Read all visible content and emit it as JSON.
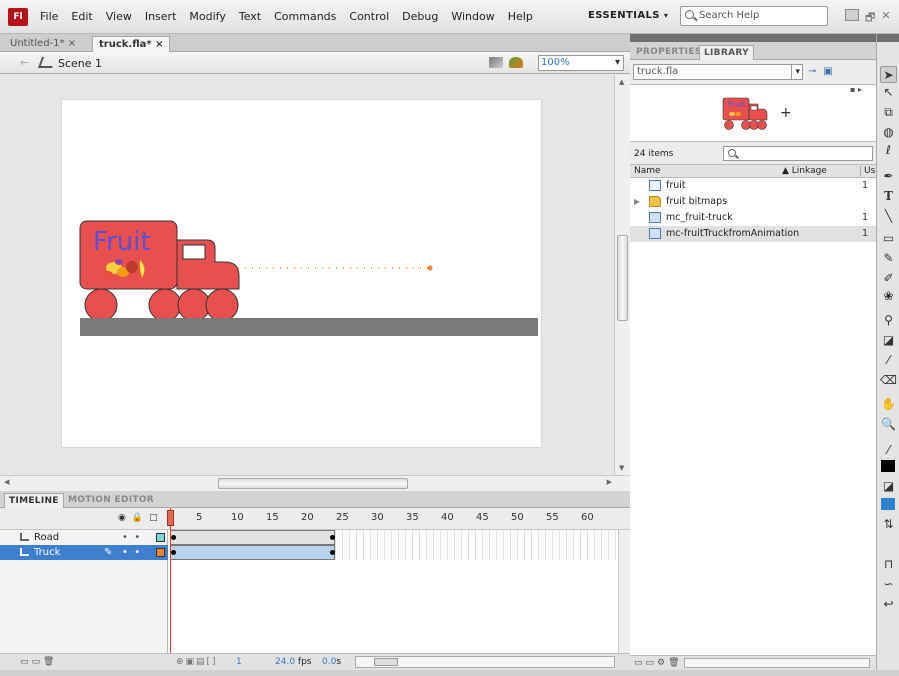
{
  "app": {
    "logo": "Fl"
  },
  "menu": [
    "File",
    "Edit",
    "View",
    "Insert",
    "Modify",
    "Text",
    "Commands",
    "Control",
    "Debug",
    "Window",
    "Help"
  ],
  "workspace": {
    "label": "ESSENTIALS",
    "arrow": "▾"
  },
  "search": {
    "placeholder": "Search Help"
  },
  "window_controls": [
    "",
    "🗗",
    "✕"
  ],
  "doc_tabs": [
    {
      "label": "Untitled-1* ×"
    },
    {
      "label": "truck.fla* ×"
    }
  ],
  "editbar": {
    "scene": "Scene 1",
    "zoom": "100%"
  },
  "stage": {
    "truck_text": "Fruit",
    "colors": {
      "truck": "#e85050",
      "road": "#7a7a7a",
      "path": "#f0832a",
      "stage_bg": "#ffffff"
    }
  },
  "timeline": {
    "tabs": [
      "TIMELINE",
      "MOTION EDITOR"
    ],
    "frame_numbers": [
      "5",
      "10",
      "15",
      "20",
      "25",
      "30",
      "35",
      "40",
      "45",
      "50",
      "55",
      "60"
    ],
    "layers": [
      {
        "name": "Road",
        "selected": false,
        "color": "#7fd8d8"
      },
      {
        "name": "Truck",
        "selected": true,
        "color": "#f0832a"
      }
    ],
    "current_frame": "1",
    "fps": "24.0",
    "fps_unit": "fps",
    "time": "0.0",
    "time_unit": "s"
  },
  "panel": {
    "tabs": [
      "PROPERTIES",
      "LIBRARY"
    ],
    "library_file": "truck.fla",
    "item_count": "24 items",
    "columns": {
      "name": "Name",
      "linkage": "Linkage",
      "use": "Us"
    },
    "items": [
      {
        "name": "fruit",
        "type": "graphic",
        "use": "1",
        "selected": false
      },
      {
        "name": "fruit bitmaps",
        "type": "folder",
        "use": "",
        "selected": false
      },
      {
        "name": "mc_fruit-truck",
        "type": "movieclip",
        "use": "1",
        "selected": false
      },
      {
        "name": "mc-fruitTruckfromAnimation",
        "type": "movieclip",
        "use": "1",
        "selected": true
      }
    ]
  },
  "tools": [
    "selection-tool",
    "subselection-tool",
    "free-transform-tool",
    "3d-rotation-tool",
    "lasso-tool",
    "pen-tool",
    "text-tool",
    "line-tool",
    "rectangle-tool",
    "pencil-tool",
    "brush-tool",
    "deco-tool",
    "bone-tool",
    "paint-bucket-tool",
    "eyedropper-tool",
    "eraser-tool",
    "hand-tool",
    "zoom-tool",
    "stroke-color",
    "fill-color",
    "swap-colors",
    "snap-option",
    "smooth-option",
    "straighten-option"
  ]
}
